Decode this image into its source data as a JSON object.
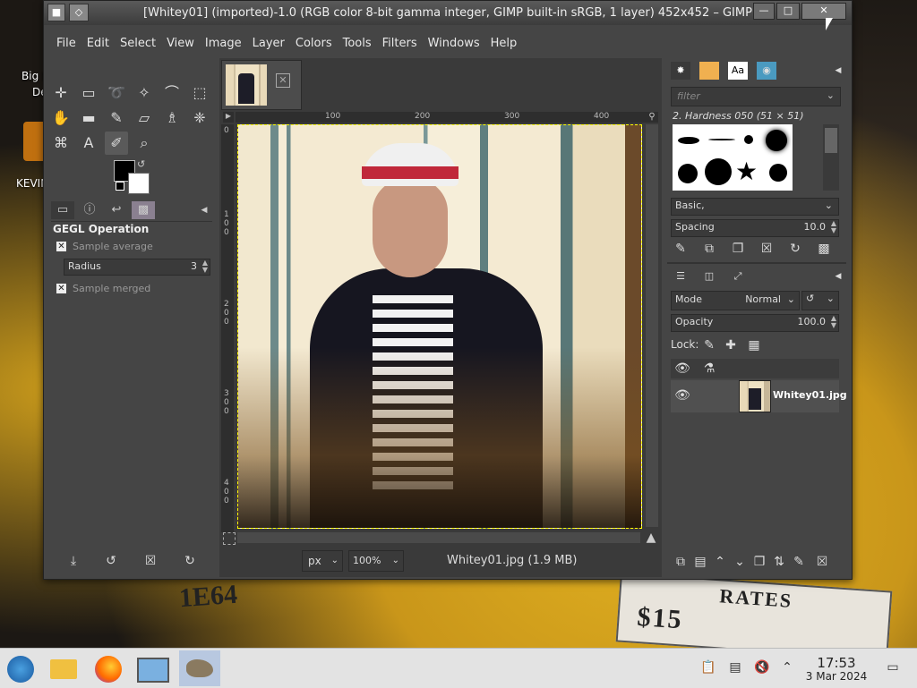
{
  "desktop": {
    "icon_labels": [
      "Big M",
      "De",
      "KEVIN"
    ],
    "plate_text": "RATES",
    "plate_number": "$15",
    "cab_number": "1E64"
  },
  "window": {
    "title": "[Whitey01] (imported)-1.0 (RGB color 8-bit gamma integer, GIMP built-in sRGB, 1 layer) 452x452 – GIMP",
    "minimize_label": "—",
    "maximize_label": "□",
    "close_label": "✕"
  },
  "menu": [
    "File",
    "Edit",
    "Select",
    "View",
    "Image",
    "Layer",
    "Colors",
    "Tools",
    "Filters",
    "Windows",
    "Help"
  ],
  "toolbox": {
    "tools": [
      {
        "name": "move-tool-icon",
        "glyph": "✛"
      },
      {
        "name": "rect-select-tool-icon",
        "glyph": "▭"
      },
      {
        "name": "lasso-tool-icon",
        "glyph": "➰"
      },
      {
        "name": "fuzzy-select-tool-icon",
        "glyph": "✧"
      },
      {
        "name": "crop-tool-icon",
        "glyph": "⌒"
      },
      {
        "name": "transform-tool-icon",
        "glyph": "⬚"
      },
      {
        "name": "warp-tool-icon",
        "glyph": "✋"
      },
      {
        "name": "bucket-fill-tool-icon",
        "glyph": "▬"
      },
      {
        "name": "paintbrush-tool-icon",
        "glyph": "✎"
      },
      {
        "name": "eraser-tool-icon",
        "glyph": "▱"
      },
      {
        "name": "clone-tool-icon",
        "glyph": "♗"
      },
      {
        "name": "smudge-tool-icon",
        "glyph": "❈"
      },
      {
        "name": "paths-tool-icon",
        "glyph": "⌘"
      },
      {
        "name": "text-tool-icon",
        "glyph": "A"
      },
      {
        "name": "color-picker-tool-icon",
        "glyph": "✐"
      },
      {
        "name": "zoom-tool-icon",
        "glyph": "⌕"
      }
    ],
    "fg_color": "#000000",
    "bg_color": "#ffffff",
    "options_title": "GEGL Operation",
    "sample_average_label": "Sample average",
    "radius_label": "Radius",
    "radius_value": "3",
    "sample_merged_label": "Sample merged"
  },
  "canvas": {
    "ruler_ticks": [
      "100",
      "200",
      "300",
      "400"
    ],
    "vruler_ticks": [
      "0",
      "1\n0\n0",
      "2\n0\n0",
      "3\n0\n0",
      "4\n0\n0"
    ],
    "unit": "px",
    "zoom": "100%",
    "status": "Whitey01.jpg (1.9 MB)"
  },
  "brushes": {
    "filter_placeholder": "filter",
    "selected_brush": "2. Hardness 050 (51 × 51)",
    "preset": "Basic,",
    "spacing_label": "Spacing",
    "spacing_value": "10.0"
  },
  "layers": {
    "mode_label": "Mode",
    "mode_value": "Normal",
    "opacity_label": "Opacity",
    "opacity_value": "100.0",
    "lock_label": "Lock:",
    "layer_name": "Whitey01.jpg"
  },
  "taskbar": {
    "time": "17:53",
    "date": "3 Mar 2024"
  }
}
